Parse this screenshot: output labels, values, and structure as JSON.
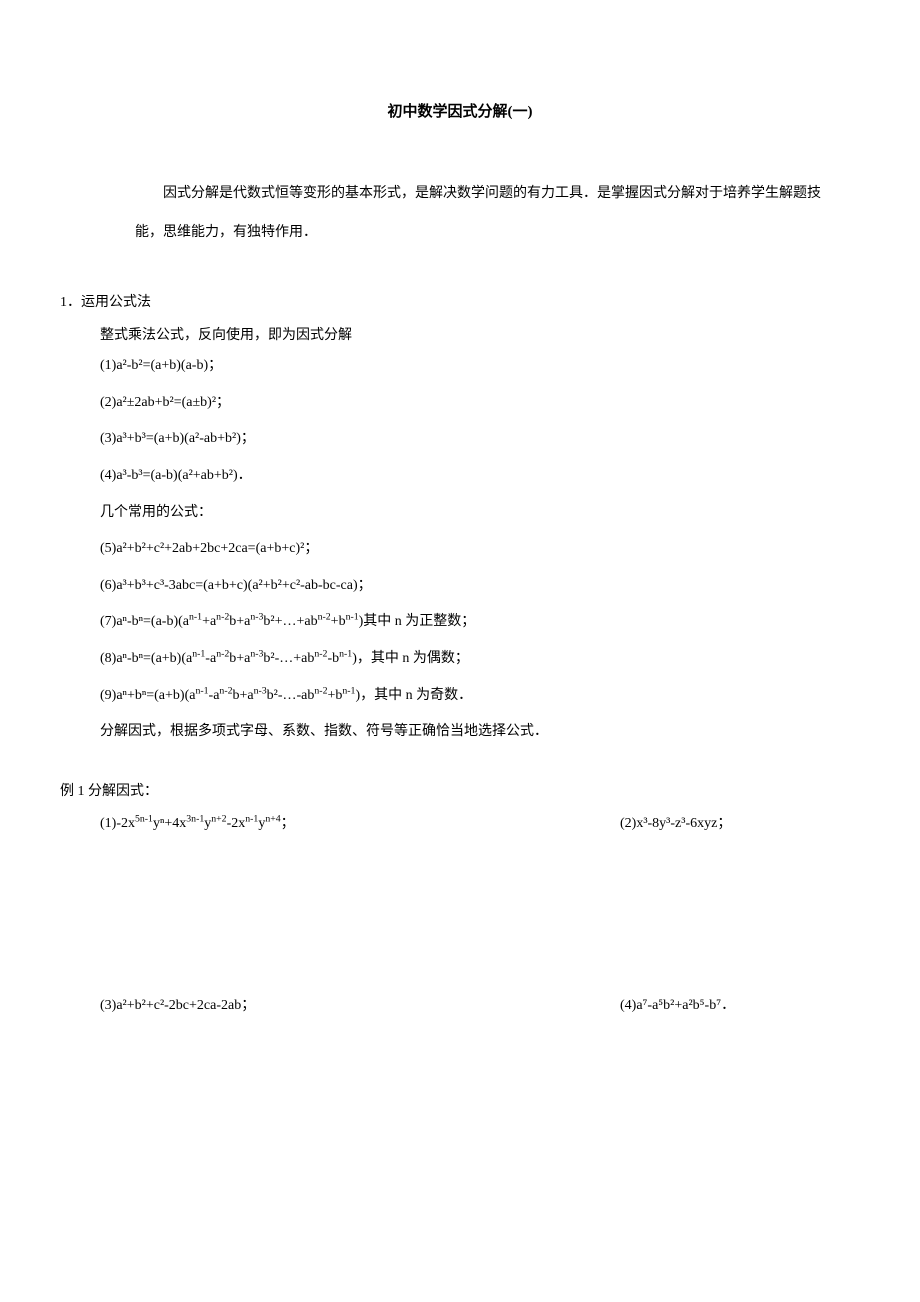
{
  "title": "初中数学因式分解(一)",
  "intro": "因式分解是代数式恒等变形的基本形式，是解决数学问题的有力工具．是掌握因式分解对于培养学生解题技能，思维能力，有独特作用．",
  "section1": {
    "header": "1．运用公式法",
    "intro": "整式乘法公式，反向使用，即为因式分解",
    "formulas": [
      "(1)a²-b²=(a+b)(a-b)；",
      "(2)a²±2ab+b²=(a±b)²；",
      "(3)a³+b³=(a+b)(a²-ab+b²)；",
      "(4)a³-b³=(a-b)(a²+ab+b²)．"
    ],
    "common_label": "几个常用的公式：",
    "formulas2": [
      "(5)a²+b²+c²+2ab+2bc+2ca=(a+b+c)²；",
      "(6)a³+b³+c³-3abc=(a+b+c)(a²+b²+c²-ab-bc-ca)；"
    ],
    "formula7_prefix": "(7)aⁿ-bⁿ=(a-b)(a",
    "formula7_sup1": "n-1",
    "formula7_mid1": "+a",
    "formula7_sup2": "n-2",
    "formula7_mid2": "b+a",
    "formula7_sup3": "n-3",
    "formula7_mid3": "b²+…+ab",
    "formula7_sup4": "n-2",
    "formula7_mid4": "+b",
    "formula7_sup5": "n-1",
    "formula7_suffix": ")其中 n 为正整数；",
    "formula8_prefix": "(8)aⁿ-bⁿ=(a+b)(a",
    "formula8_sup1": "n-1",
    "formula8_mid1": "-a",
    "formula8_sup2": "n-2",
    "formula8_mid2": "b+a",
    "formula8_sup3": "n-3",
    "formula8_mid3": "b²-…+ab",
    "formula8_sup4": "n-2",
    "formula8_mid4": "-b",
    "formula8_sup5": "n-1",
    "formula8_suffix": ")，其中 n 为偶数；",
    "formula9_prefix": "(9)aⁿ+bⁿ=(a+b)(a",
    "formula9_sup1": "n-1",
    "formula9_mid1": "-a",
    "formula9_sup2": "n-2",
    "formula9_mid2": "b+a",
    "formula9_sup3": "n-3",
    "formula9_mid3": "b²-…-ab",
    "formula9_sup4": "n-2",
    "formula9_mid4": "+b",
    "formula9_sup5": "n-1",
    "formula9_suffix": ")，其中 n 为奇数．",
    "note": "分解因式，根据多项式字母、系数、指数、符号等正确恰当地选择公式．"
  },
  "example1": {
    "header": "例 1 分解因式：",
    "p1_prefix": "(1)-2x",
    "p1_sup1": "5n-1",
    "p1_mid1": "yⁿ+4x",
    "p1_sup2": "3n-1",
    "p1_mid2": "y",
    "p1_sup3": "n+2",
    "p1_mid3": "-2x",
    "p1_sup4": "n-1",
    "p1_mid4": "y",
    "p1_sup5": "n+4",
    "p1_suffix": "；",
    "p2": "(2)x³-8y³-z³-6xyz；",
    "p3": "(3)a²+b²+c²-2bc+2ca-2ab；",
    "p4": "(4)a⁷-a⁵b²+a²b⁵-b⁷．"
  }
}
